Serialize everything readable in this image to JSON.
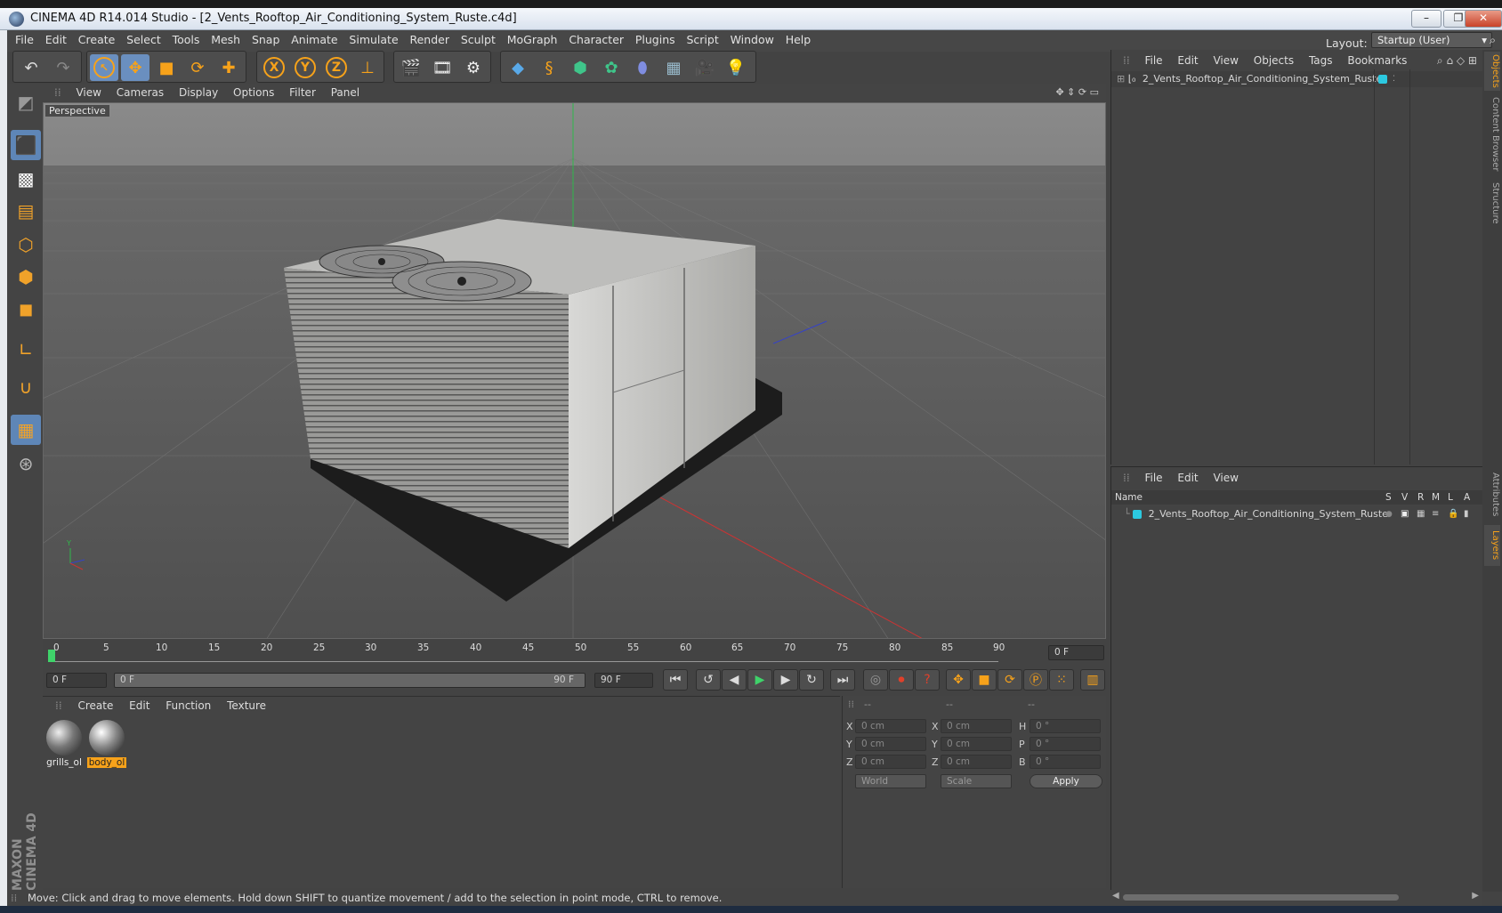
{
  "window": {
    "title": "CINEMA 4D R14.014 Studio - [2_Vents_Rooftop_Air_Conditioning_System_Ruste.c4d]"
  },
  "menu": [
    "File",
    "Edit",
    "Create",
    "Select",
    "Tools",
    "Mesh",
    "Snap",
    "Animate",
    "Simulate",
    "Render",
    "Sculpt",
    "MoGraph",
    "Character",
    "Plugins",
    "Script",
    "Window",
    "Help"
  ],
  "layout": {
    "label": "Layout:",
    "value": "Startup (User)"
  },
  "viewport": {
    "menu": [
      "View",
      "Cameras",
      "Display",
      "Options",
      "Filter",
      "Panel"
    ],
    "label": "Perspective"
  },
  "timeline": {
    "ticks": [
      "0",
      "5",
      "10",
      "15",
      "20",
      "25",
      "30",
      "35",
      "40",
      "45",
      "50",
      "55",
      "60",
      "65",
      "70",
      "75",
      "80",
      "85",
      "90"
    ],
    "current_frame": "0 F"
  },
  "frames": {
    "start": "0 F",
    "range_start": "0 F",
    "range_end": "90 F",
    "end": "90 F"
  },
  "materials": {
    "menu": [
      "Create",
      "Edit",
      "Function",
      "Texture"
    ],
    "items": [
      {
        "name": "grills_ol",
        "selected": false
      },
      {
        "name": "body_ol",
        "selected": true
      }
    ]
  },
  "coords": {
    "col1": "--",
    "col2": "--",
    "col3": "--",
    "x": "0 cm",
    "y": "0 cm",
    "z": "0 cm",
    "sx": "0 cm",
    "sy": "0 cm",
    "sz": "0 cm",
    "h": "0 °",
    "p": "0 °",
    "b": "0 °",
    "world": "World",
    "scale": "Scale",
    "apply": "Apply",
    "labels": {
      "x": "X",
      "y": "Y",
      "z": "Z",
      "h": "H",
      "p": "P",
      "b": "B"
    }
  },
  "objects": {
    "menu": [
      "File",
      "Edit",
      "View",
      "Objects",
      "Tags",
      "Bookmarks"
    ],
    "item": "2_Vents_Rooftop_Air_Conditioning_System_Ruste"
  },
  "layers": {
    "menu": [
      "File",
      "Edit",
      "View"
    ],
    "header": {
      "name": "Name",
      "cols": [
        "S",
        "V",
        "R",
        "M",
        "L",
        "A"
      ]
    },
    "item": "2_Vents_Rooftop_Air_Conditioning_System_Ruste"
  },
  "right_tabs": [
    "Objects",
    "Content Browser",
    "Structure",
    "Attributes",
    "Layers"
  ],
  "status": "Move: Click and drag to move elements. Hold down SHIFT to quantize movement / add to the selection in point mode, CTRL to remove.",
  "brand": {
    "line1": "MAXON",
    "line2": "CINEMA 4D"
  },
  "colors": {
    "accent": "#f7a21a",
    "selection": "#5e86b7",
    "layer": "#2cc9e0"
  }
}
